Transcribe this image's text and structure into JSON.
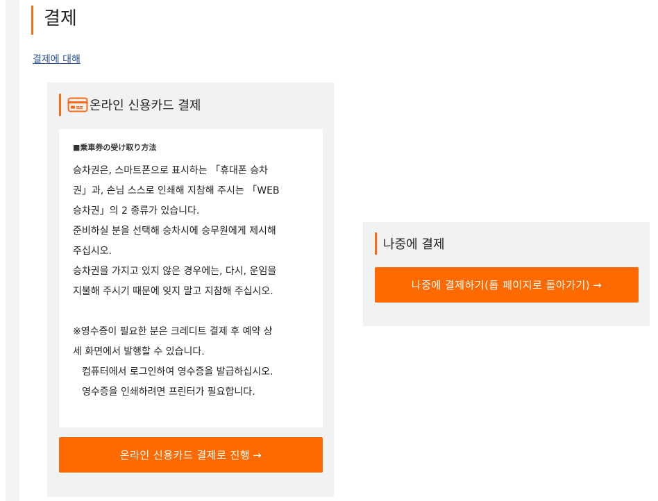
{
  "page": {
    "title": "결제",
    "about_link": "결제에 대해"
  },
  "online_payment": {
    "heading": "온라인 신용카드 결제",
    "icon": "credit-card-icon",
    "info_heading": "■乗車券の受け取り方法",
    "lines": [
      "승차권은, 스마트폰으로 표시하는 「휴대폰 승차",
      "권」과, 손님 스스로 인쇄해 지참해 주시는 「WEB",
      "승차권」의 2 종류가 있습니다.",
      "준비하실 분을 선택해 승차시에 승무원에게 제시해",
      "주십시오.",
      "승차권을 가지고 있지 않은 경우에는, 다시, 운임을",
      "지불해 주시기 때문에 잊지 말고 지참해 주십시오."
    ],
    "note_lines": [
      "※영수증이 필요한 분은 크레디트 결제 후 예약 상",
      "세 화면에서 발행할 수 있습니다."
    ],
    "indent_lines": [
      "컴퓨터에서 로그인하여 영수증을 발급하십시오.",
      "영수증을 인쇄하려면 프린터가 필요합니다."
    ],
    "button_label": "온라인 신용카드 결제로 진행",
    "button_arrow": "→"
  },
  "later_payment": {
    "heading": "나중에 결제",
    "button_label": "나중에 결제하기(톱 페이지로 돌아가기)",
    "button_arrow": "→"
  },
  "colors": {
    "accent": "#ff6a13",
    "button": "#ff6a00",
    "panel": "#f0f2f3",
    "link": "#2b4f93"
  }
}
